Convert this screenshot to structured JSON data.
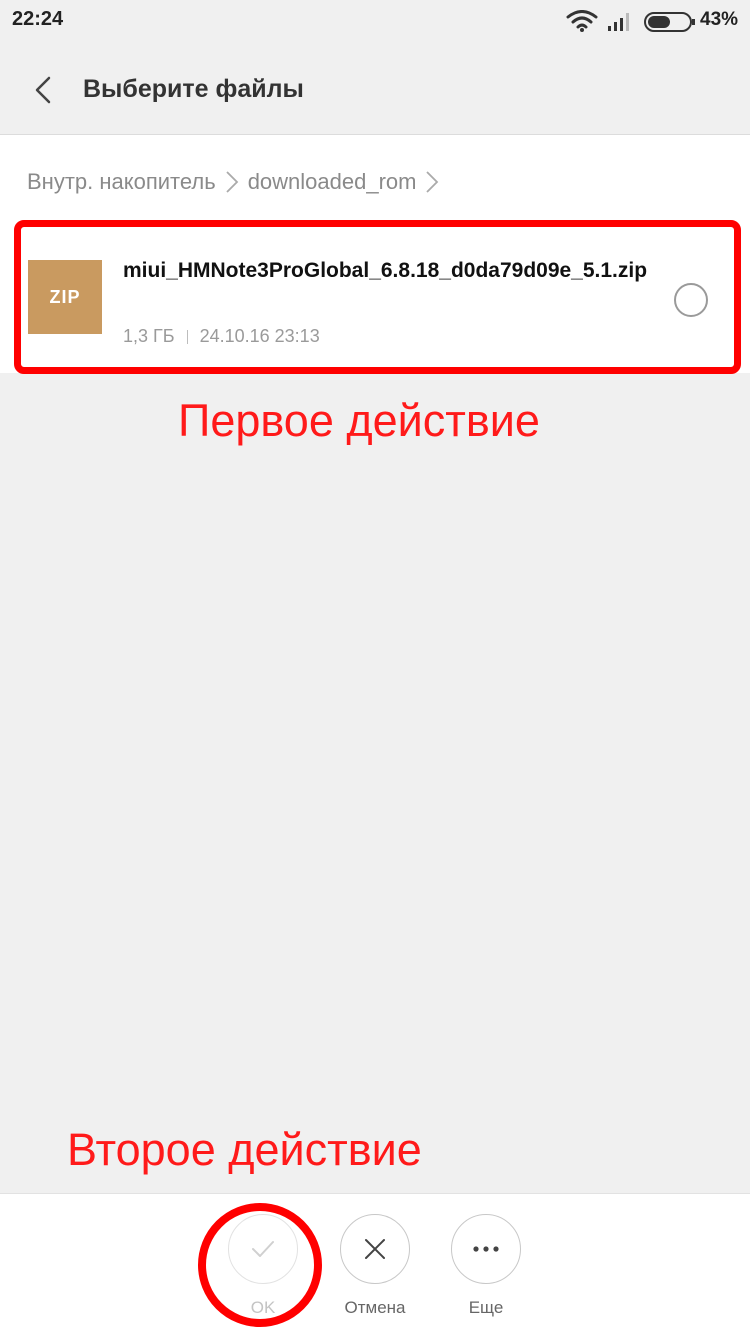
{
  "status_bar": {
    "time": "22:24",
    "battery": "43%"
  },
  "header": {
    "title": "Выберите файлы"
  },
  "breadcrumb": {
    "items": [
      "Внутр. накопитель",
      "downloaded_rom"
    ]
  },
  "file": {
    "type_badge": "ZIP",
    "name": "miui_HMNote3ProGlobal_6.8.18_d0da79d09e_5.1.zip",
    "size": "1,3 ГБ",
    "modified": "24.10.16 23:13"
  },
  "annotations": {
    "first": "Первое действие",
    "second": "Второе действие"
  },
  "bottom_bar": {
    "ok_label": "OK",
    "cancel_label": "Отмена",
    "more_label": "Еще"
  },
  "colors": {
    "highlight": "#ff0000",
    "zip_badge": "#c99a60",
    "background": "#f0f0f0"
  }
}
